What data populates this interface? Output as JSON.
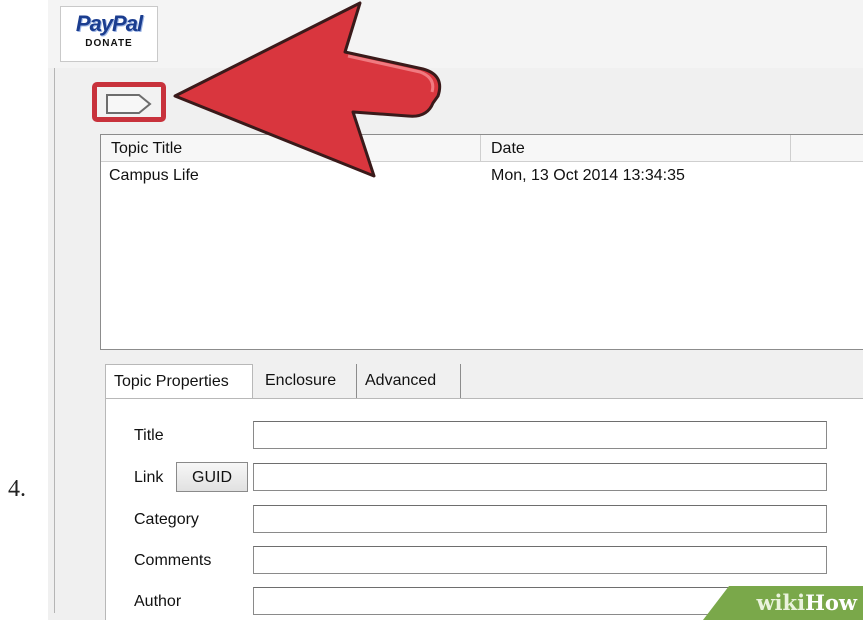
{
  "step": {
    "number": "4."
  },
  "paypal": {
    "logo_text": "PayPal",
    "button_label": "DONATE"
  },
  "topics_list": {
    "columns": [
      "Topic Title",
      "Date"
    ],
    "rows": [
      {
        "title": "Campus Life",
        "date": "Mon, 13 Oct 2014 13:34:35"
      }
    ]
  },
  "tabs": [
    {
      "label": "Topic Properties",
      "active": true
    },
    {
      "label": "Enclosure",
      "active": false
    },
    {
      "label": "Advanced",
      "active": false
    }
  ],
  "properties_form": {
    "title_label": "Title",
    "link_label": "Link",
    "guid_button": "GUID",
    "category_label": "Category",
    "comments_label": "Comments",
    "author_label": "Author",
    "title_value": "",
    "link_value": "",
    "category_value": "",
    "comments_value": "",
    "author_value": ""
  },
  "watermark": {
    "prefix": "wiki",
    "suffix": "How"
  },
  "colors": {
    "highlight_red": "#c8323c",
    "arrow_red": "#d9363e",
    "watermark_green": "#7aa84a"
  },
  "icons": {
    "toolbar_button": "tag-icon",
    "pointer": "arrow-icon"
  }
}
